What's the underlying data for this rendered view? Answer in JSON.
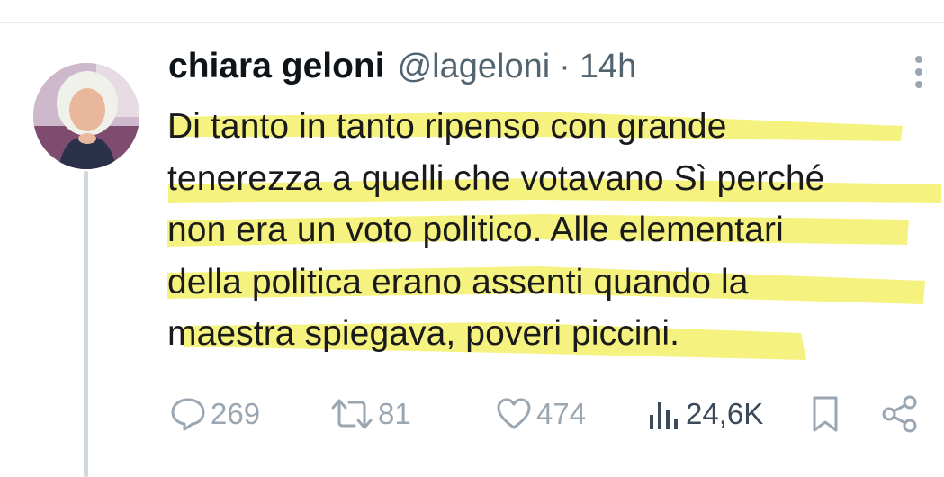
{
  "tweet": {
    "author_name": "chiara geloni",
    "handle": "@lageloni",
    "separator": "·",
    "time": "14h",
    "text_lines": [
      "Di tanto in tanto ripenso con grande",
      "tenerezza a quelli che votavano Sì perché",
      "non era un voto politico. Alle elementari",
      "della politica erano assenti quando la",
      "maestra spiegava, poveri piccini."
    ],
    "highlight_color": "#f3f06a"
  },
  "actions": {
    "replies": "269",
    "retweets": "81",
    "likes": "474",
    "views": "24,6K"
  },
  "icons": {
    "reply": "reply-icon",
    "retweet": "retweet-icon",
    "like": "heart-icon",
    "views": "views-icon",
    "bookmark": "bookmark-icon",
    "share": "share-icon",
    "more": "more-vertical-icon"
  }
}
